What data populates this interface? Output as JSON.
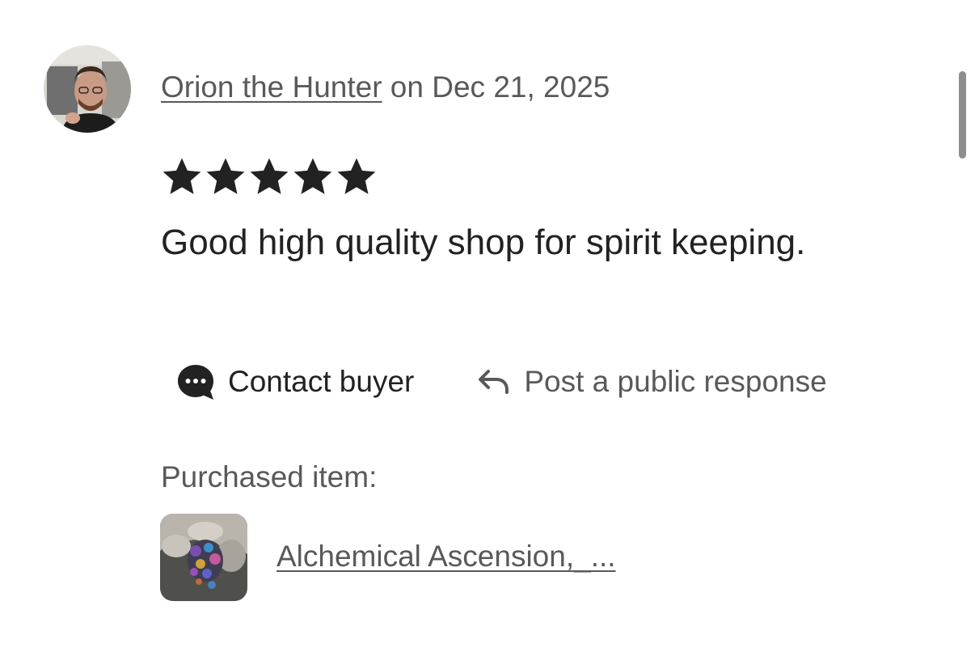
{
  "review": {
    "author_name": "Orion the Hunter",
    "date_prefix": " on ",
    "date": "Dec 21, 2025",
    "rating": 5,
    "text": "Good high quality shop for spirit keeping."
  },
  "actions": {
    "contact_label": "Contact buyer",
    "contact_icon": "chat-bubble-icon",
    "respond_label": "Post a public response",
    "respond_icon": "reply-arrow-icon"
  },
  "purchase": {
    "label": "Purchased item:",
    "item_title": "Alchemical Ascension,_..."
  },
  "colors": {
    "primary_text": "#222222",
    "secondary_text": "#595959",
    "scrollbar": "#8e8e8e"
  }
}
